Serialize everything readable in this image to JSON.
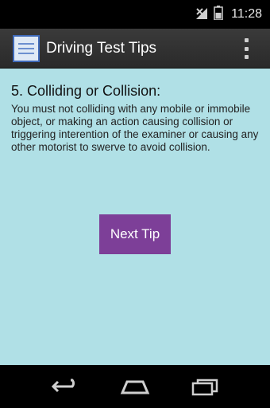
{
  "status_bar": {
    "time": "11:28",
    "icons": [
      "signal-icon",
      "battery-icon"
    ]
  },
  "action_bar": {
    "title": "Driving Test Tips",
    "icon": "app-logo-icon",
    "menu_icon": "overflow-menu-icon"
  },
  "tip": {
    "heading": "5. Colliding or Collision:",
    "body": "You must not colliding with any mobile or immobile object, or making an action causing collision or triggering interention of the examiner or causing any other motorist to swerve to avoid collision."
  },
  "actions": {
    "next_label": "Next Tip"
  },
  "nav_bar": {
    "icons": [
      "back-icon",
      "home-icon",
      "recent-apps-icon"
    ]
  },
  "colors": {
    "content_background": "#b0e0e6",
    "button_background": "#7d3f98",
    "action_bar_background": "#333333"
  }
}
